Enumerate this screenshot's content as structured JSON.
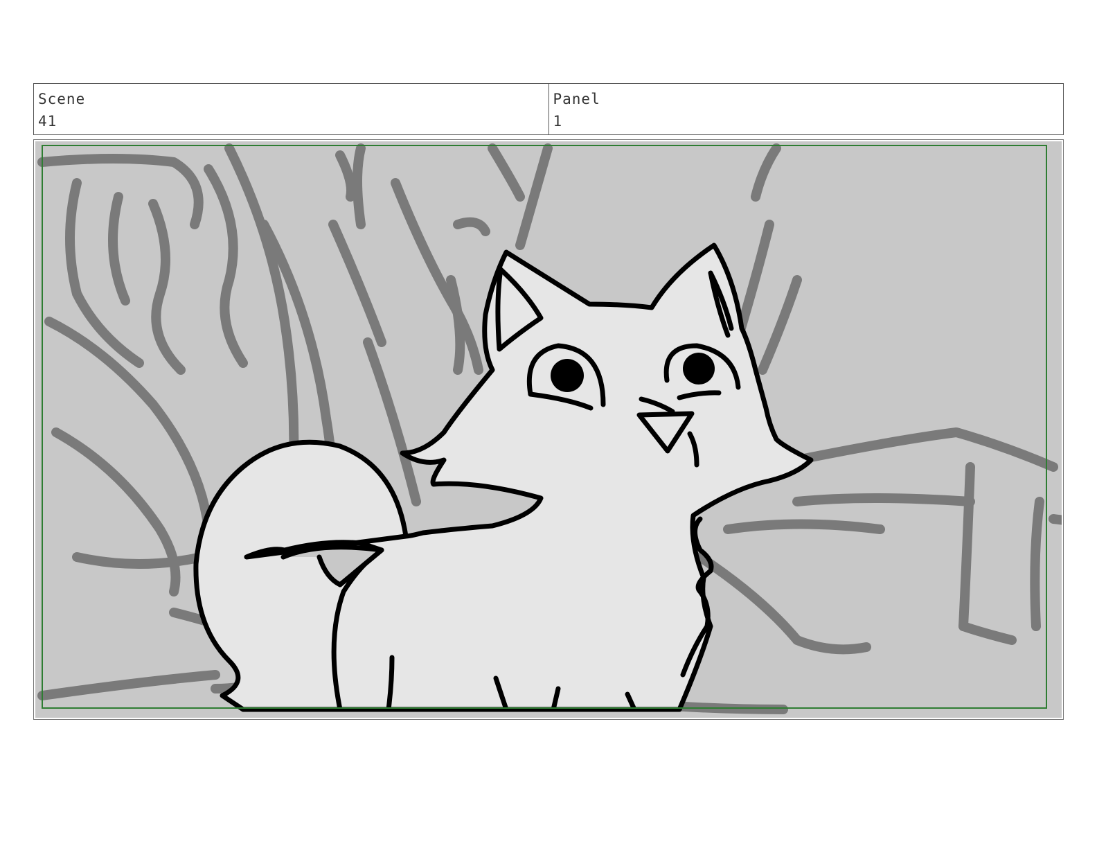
{
  "header": {
    "scene": {
      "label": "Scene",
      "value": "41"
    },
    "panel": {
      "label": "Panel",
      "value": "1"
    }
  },
  "panel_image": {
    "description_icon": "cat-sketch-illustration",
    "colors": {
      "background": "#c8c8c8",
      "sketch_lines": "#7a7a7a",
      "cat_fill": "#e6e6e6",
      "outline": "#000000",
      "safe_frame": "#2e7d32"
    }
  }
}
